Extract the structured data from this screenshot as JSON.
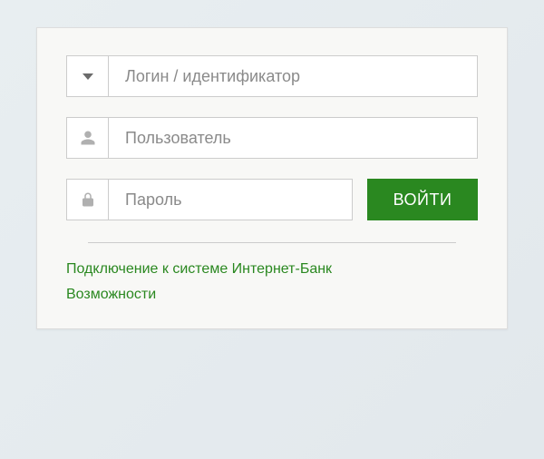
{
  "form": {
    "login_type_placeholder": "Логин / идентификатор",
    "username_placeholder": "Пользователь",
    "password_placeholder": "Пароль",
    "submit_label": "ВОЙТИ"
  },
  "links": {
    "connect_label": "Подключение к системе Интернет-Банк",
    "features_label": "Возможности"
  },
  "colors": {
    "accent": "#2a8820"
  }
}
